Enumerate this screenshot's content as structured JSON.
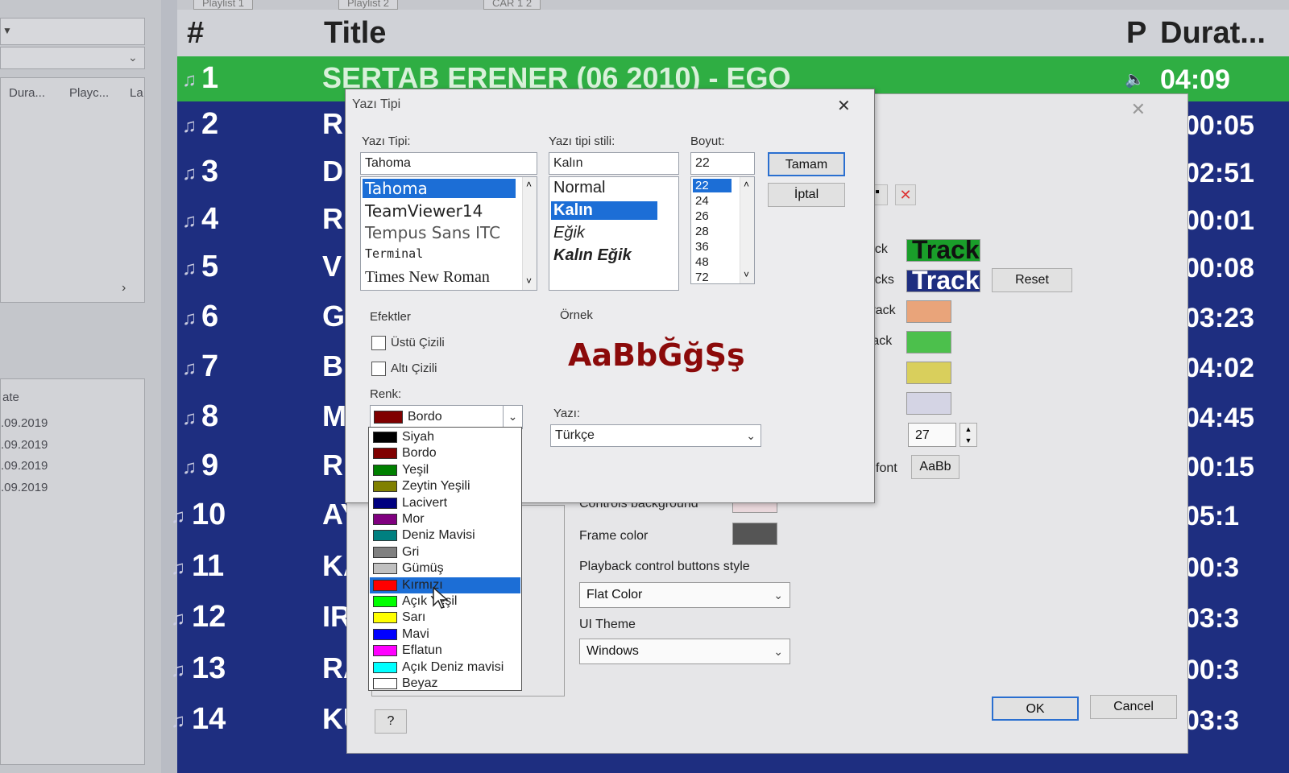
{
  "left_panel": {
    "columns": [
      "Dura...",
      "Playc...",
      "La"
    ],
    "date_header": "ate",
    "dates": [
      ".09.2019",
      ".09.2019",
      ".09.2019",
      ".09.2019"
    ]
  },
  "playlist": {
    "tabs": [
      "Playlist 1",
      "Playlist 2",
      "CAR 1 2"
    ],
    "header": {
      "num": "#",
      "title": "Title",
      "p": "P",
      "duration": "Durat..."
    },
    "rows": [
      {
        "num": "1",
        "title": "SERTAB ERENER   (06  2010) - EGO",
        "duration": "04:09"
      },
      {
        "num": "2",
        "title": "R",
        "duration": "00:05"
      },
      {
        "num": "3",
        "title": "D",
        "duration": "02:51"
      },
      {
        "num": "4",
        "title": "R",
        "duration": "00:01"
      },
      {
        "num": "5",
        "title": "V",
        "duration": "00:08"
      },
      {
        "num": "6",
        "title": "G",
        "duration": "03:23"
      },
      {
        "num": "7",
        "title": "B",
        "duration": "04:02"
      },
      {
        "num": "8",
        "title": "M",
        "duration": "04:45"
      },
      {
        "num": "9",
        "title": "R",
        "duration": "00:15"
      },
      {
        "num": "10",
        "title": "AY",
        "duration": "05:1"
      },
      {
        "num": "11",
        "title": "KA",
        "duration": "00:3"
      },
      {
        "num": "12",
        "title": "IR",
        "duration": "03:3"
      },
      {
        "num": "13",
        "title": "RA",
        "duration": "00:3"
      },
      {
        "num": "14",
        "title": "KU",
        "duration": "03:3"
      }
    ],
    "colors": {
      "playing_row": "#2fae43",
      "background": "#1e2e80",
      "header": "#d0d2d7"
    }
  },
  "settings": {
    "rows": [
      {
        "label": "ack",
        "swatch_text": "Track",
        "swatch_color": "#1a9e2a"
      },
      {
        "label": "acks",
        "swatch_text": "Track",
        "swatch_color": "#1e2e80"
      },
      {
        "label": "track",
        "swatch_color": "#e9a47a"
      },
      {
        "label": "rack",
        "swatch_color": "#4cc04c"
      },
      {
        "label": "k",
        "swatch_color": "#d9cf5c"
      },
      {
        "label": "r",
        "swatch_color": "#d4d4e4"
      }
    ],
    "reset_label": "Reset",
    "size_value": "27",
    "font_label": "font",
    "font_button": "AaBb",
    "controls_bg_label": "Controls background",
    "frame_color_label": "Frame color",
    "playback_style_label": "Playback control buttons style",
    "playback_style_value": "Flat Color",
    "ui_theme_label": "UI Theme",
    "ui_theme_value": "Windows",
    "ok_label": "OK",
    "cancel_label": "Cancel",
    "help_label": "?"
  },
  "font_dialog": {
    "title": "Yazı Tipi",
    "font_label": "Yazı Tipi:",
    "font_value": "Tahoma",
    "fonts": [
      "Tahoma",
      "TeamViewer14",
      "Tempus Sans ITC",
      "Terminal",
      "Times New Roman"
    ],
    "style_label": "Yazı tipi stili:",
    "style_value": "Kalın",
    "styles": [
      "Normal",
      "Kalın",
      "Eğik",
      "Kalın Eğik"
    ],
    "size_label": "Boyut:",
    "size_value": "22",
    "sizes": [
      "22",
      "24",
      "26",
      "28",
      "36",
      "48",
      "72"
    ],
    "ok_button": "Tamam",
    "cancel_button": "İptal",
    "effects_label": "Efektler",
    "strikeout_label": "Üstü Çizili",
    "underline_label": "Altı Çizili",
    "color_label": "Renk:",
    "color_value": "Bordo",
    "sample_label": "Örnek",
    "sample_text": "AaBbĞğŞş",
    "script_label": "Yazı:",
    "script_value": "Türkçe",
    "colors": [
      {
        "name": "Siyah",
        "hex": "#000000"
      },
      {
        "name": "Bordo",
        "hex": "#800000"
      },
      {
        "name": "Yeşil",
        "hex": "#008000"
      },
      {
        "name": "Zeytin Yeşili",
        "hex": "#808000"
      },
      {
        "name": "Lacivert",
        "hex": "#000080"
      },
      {
        "name": "Mor",
        "hex": "#800080"
      },
      {
        "name": "Deniz Mavisi",
        "hex": "#008080"
      },
      {
        "name": "Gri",
        "hex": "#808080"
      },
      {
        "name": "Gümüş",
        "hex": "#c0c0c0"
      },
      {
        "name": "Kırmızı",
        "hex": "#ff0000"
      },
      {
        "name": "Açık Yeşil",
        "hex": "#00ff00"
      },
      {
        "name": "Sarı",
        "hex": "#ffff00"
      },
      {
        "name": "Mavi",
        "hex": "#0000ff"
      },
      {
        "name": "Eflatun",
        "hex": "#ff00ff"
      },
      {
        "name": "Açık Deniz mavisi",
        "hex": "#00ffff"
      },
      {
        "name": "Beyaz",
        "hex": "#ffffff"
      }
    ],
    "selected_color_index": 9
  }
}
